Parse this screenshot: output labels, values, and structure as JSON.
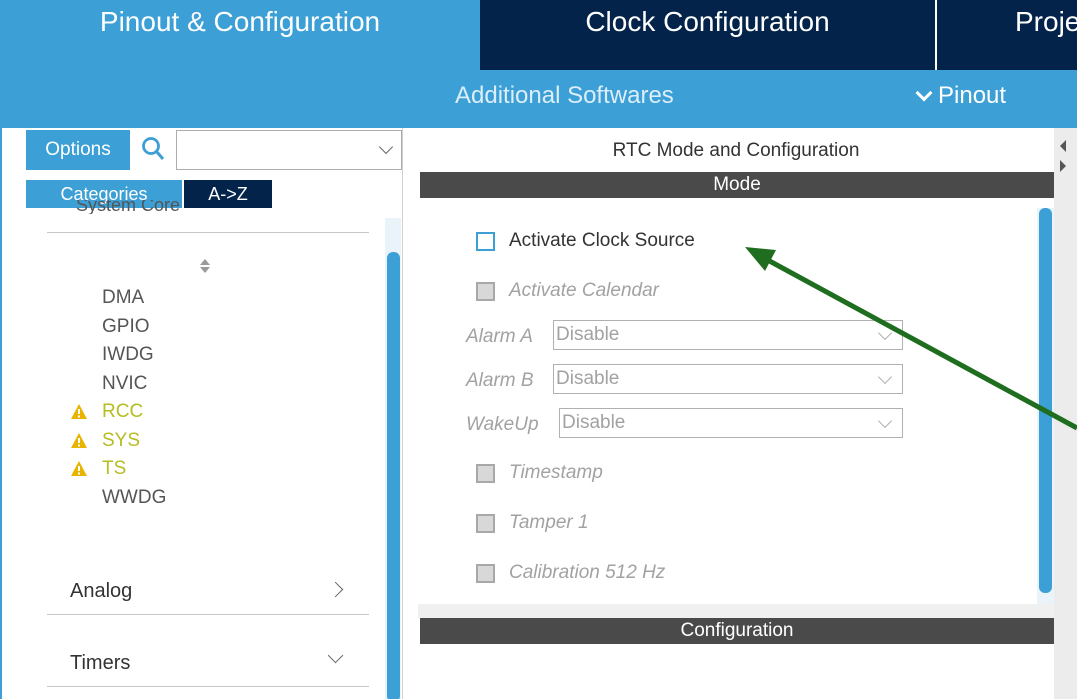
{
  "tabs": {
    "pinout": "Pinout & Configuration",
    "clock": "Clock Configuration",
    "project": "Project Manager"
  },
  "subbar": {
    "additional": "Additional Softwares",
    "pinout": "Pinout"
  },
  "left": {
    "options": "Options",
    "search_value": "",
    "categories": "Categories",
    "az": "A->Z",
    "partial_category": "System Core",
    "items": [
      {
        "label": "DMA",
        "warn": false
      },
      {
        "label": "GPIO",
        "warn": false
      },
      {
        "label": "IWDG",
        "warn": false
      },
      {
        "label": "NVIC",
        "warn": false
      },
      {
        "label": "RCC",
        "warn": true
      },
      {
        "label": "SYS",
        "warn": true
      },
      {
        "label": "TS",
        "warn": true
      },
      {
        "label": "WWDG",
        "warn": false
      }
    ],
    "analog": "Analog",
    "timers": "Timers"
  },
  "right": {
    "title": "RTC Mode and Configuration",
    "mode_header": "Mode",
    "activate_clock": "Activate Clock Source",
    "activate_calendar": "Activate Calendar",
    "alarm_a_label": "Alarm A",
    "alarm_a_value": "Disable",
    "alarm_b_label": "Alarm B",
    "alarm_b_value": "Disable",
    "wakeup_label": "WakeUp",
    "wakeup_value": "Disable",
    "timestamp": "Timestamp",
    "tamper": "Tamper 1",
    "calibration": "Calibration 512 Hz",
    "config_header": "Configuration"
  },
  "colors": {
    "accent": "#3c9fd6",
    "navy": "#03234b",
    "warning": "#b5bd21",
    "arrow": "#1f6e1f"
  }
}
